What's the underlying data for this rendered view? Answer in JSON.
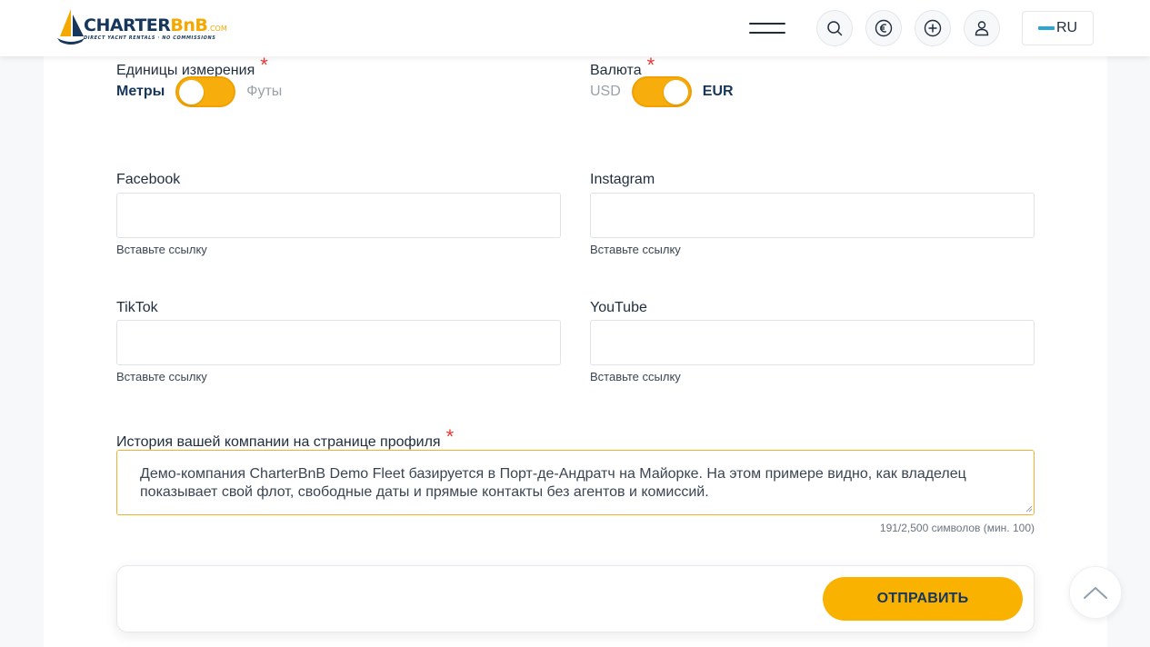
{
  "header": {
    "logo": {
      "word_main": "CHARTER",
      "word_accent": "BnB",
      "word_suffix": ".COM",
      "tagline": "DIRECT YACHT RENTALS · NO COMMISSIONS"
    },
    "icons": [
      "menu-icon",
      "search-icon",
      "euro-icon",
      "add-icon",
      "user-icon"
    ],
    "language": "RU"
  },
  "units": {
    "label": "Единицы измерения",
    "required_mark": "*",
    "option_left": "Метры",
    "option_right": "Футы",
    "selected": "Метры"
  },
  "currency": {
    "label": "Валюта",
    "required_mark": "*",
    "option_left": "USD",
    "option_right": "EUR",
    "selected": "EUR"
  },
  "socials": {
    "facebook": {
      "label": "Facebook",
      "value": "",
      "hint": "Вставьте ссылку"
    },
    "instagram": {
      "label": "Instagram",
      "value": "",
      "hint": "Вставьте ссылку"
    },
    "tiktok": {
      "label": "TikTok",
      "value": "",
      "hint": "Вставьте ссылку"
    },
    "youtube": {
      "label": "YouTube",
      "value": "",
      "hint": "Вставьте ссылку"
    }
  },
  "history": {
    "label": "История вашей компании на странице профиля",
    "required_mark": "*",
    "value": "Демо-компания CharterBnB Demo Fleet базируется в Порт-де-Андратч на Майорке. На этом примере видно, как владелец показывает свой флот, свободные даты и прямые контакты без агентов и комиссий.",
    "counter": "191/2,500 символов (мин. 100)"
  },
  "submit": {
    "label": "ОТПРАВИТЬ"
  },
  "colors": {
    "accent": "#f9b200",
    "navy": "#17365c",
    "required": "#e53935"
  }
}
